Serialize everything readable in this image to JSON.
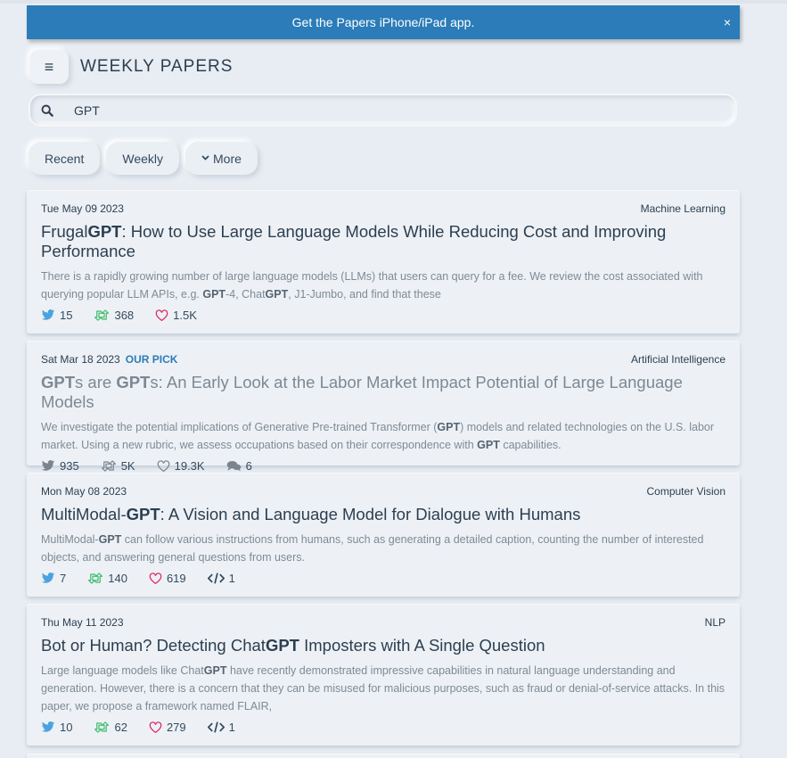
{
  "banner": {
    "text": "Get the Papers iPhone/iPad app.",
    "close": "×"
  },
  "header": {
    "title": "WEEKLY PAPERS",
    "menu_icon": "≡"
  },
  "search": {
    "value": "GPT",
    "placeholder": ""
  },
  "filters": {
    "recent": "Recent",
    "weekly": "Weekly",
    "more": "More",
    "more_icon": "⌄"
  },
  "colors": {
    "accent": "#2b7cb8",
    "retweet": "#3ebd6b",
    "like": "#e0245e",
    "twitter": "#4aa3df"
  },
  "papers": [
    {
      "date": "Tue May 09 2023",
      "pick": "",
      "category": "Machine Learning",
      "title_parts": [
        "Frugal",
        "GPT",
        ": How to Use Large Language Models While Reducing Cost and Improving Performance"
      ],
      "abstract_parts": [
        "There is a rapidly growing number of large language models (LLMs) that users can query for a fee. We review the cost associated with querying popular LLM APIs, e.g. ",
        "GPT",
        "-4, Chat",
        "GPT",
        ", J1-Jumbo, and find that these"
      ],
      "tweets": "15",
      "retweets": "368",
      "likes": "1.5K"
    },
    {
      "date": "Sat Mar 18 2023",
      "pick": "OUR PICK",
      "category": "Artificial Intelligence",
      "title_parts": [
        "GPT",
        "s are ",
        "GPT",
        "s: An Early Look at the Labor Market Impact Potential of Large Language Models"
      ],
      "abstract_parts": [
        "We investigate the potential implications of Generative Pre-trained Transformer (",
        "GPT",
        ") models and related technologies on the U.S. labor market. Using a new rubric, we assess occupations based on their correspondence with ",
        "GPT",
        " capabilities."
      ],
      "tweets": "935",
      "retweets": "5K",
      "likes": "19.3K",
      "comments": "6"
    },
    {
      "date": "Mon May 08 2023",
      "pick": "",
      "category": "Computer Vision",
      "title_parts": [
        "MultiModal-",
        "GPT",
        ": A Vision and Language Model for Dialogue with Humans"
      ],
      "abstract_parts": [
        "MultiModal-",
        "GPT",
        " can follow various instructions from humans, such as generating a detailed caption, counting the number of interested objects, and answering general questions from users."
      ],
      "tweets": "7",
      "retweets": "140",
      "likes": "619",
      "code": "1"
    },
    {
      "date": "Thu May 11 2023",
      "pick": "",
      "category": "NLP",
      "title_parts": [
        "Bot or Human? Detecting Chat",
        "GPT",
        " Imposters with A Single Question"
      ],
      "abstract_parts": [
        "Large language models like Chat",
        "GPT",
        " have recently demonstrated impressive capabilities in natural language understanding and generation. However, there is a concern that they can be misused for malicious purposes, such as fraud or denial-of-service attacks. In this paper, we propose a framework named FLAIR,"
      ],
      "tweets": "10",
      "retweets": "62",
      "likes": "279",
      "code": "1"
    }
  ]
}
